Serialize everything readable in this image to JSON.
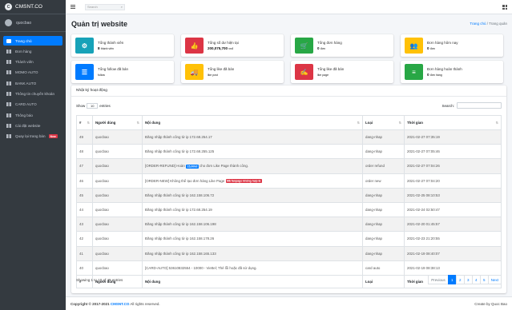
{
  "brand": {
    "name": "CMSNT.CO"
  },
  "user": {
    "name": "quocbao"
  },
  "nav": [
    {
      "label": "Trang chủ",
      "active": true
    },
    {
      "label": "Đơn hàng"
    },
    {
      "label": "Thành viên"
    },
    {
      "label": "MOMO AUTO"
    },
    {
      "label": "BANK AUTO"
    },
    {
      "label": "Thông tin chuyển khoản"
    },
    {
      "label": "CARD AUTO"
    },
    {
      "label": "Thông báo"
    },
    {
      "label": "Cài đặt website"
    },
    {
      "label": "Quay lại trang bán",
      "badge": "New"
    }
  ],
  "topbar": {
    "search_placeholder": "Search"
  },
  "header": {
    "title": "Quản trị website",
    "crumb_home": "Trang chủ",
    "crumb_sep": " / ",
    "crumb_current": "Trang quản"
  },
  "colors": {
    "teal": "#17a2b8",
    "red": "#dc3545",
    "green": "#28a745",
    "yellow": "#ffc107",
    "blue": "#007bff"
  },
  "stats": [
    {
      "label": "Tổng thành viên",
      "value": "8",
      "unit": "thành viên",
      "icon": "gear-icon",
      "color": "#17a2b8",
      "glyph": "⚙"
    },
    {
      "label": "Tổng số dư hiện tại",
      "value": "200,075,700",
      "unit": "vnđ",
      "icon": "thumbs-up-icon",
      "color": "#dc3545",
      "glyph": "👍"
    },
    {
      "label": "Tổng đơn hàng",
      "value": "0",
      "unit": "đơn",
      "icon": "cart-icon",
      "color": "#28a745",
      "glyph": "🛒"
    },
    {
      "label": "Đơn hàng hôm nay",
      "value": "0",
      "unit": "đơn",
      "icon": "users-icon",
      "color": "#ffc107",
      "glyph": "👥"
    },
    {
      "label": "Tổng follow đã bán",
      "value": "",
      "unit": "follow",
      "icon": "list-icon",
      "color": "#007bff",
      "glyph": "☰"
    },
    {
      "label": "Tổng like đã bán",
      "value": "",
      "unit": "like post",
      "icon": "truck-icon",
      "color": "#ffc107",
      "glyph": "🚚"
    },
    {
      "label": "Tổng like đã bán",
      "value": "",
      "unit": "like page",
      "icon": "signature-icon",
      "color": "#dc3545",
      "glyph": "✍"
    },
    {
      "label": "Đơn hàng hoàn thành",
      "value": "0",
      "unit": "đơn hàng",
      "icon": "align-icon",
      "color": "#28a745",
      "glyph": "≡"
    }
  ],
  "activity": {
    "title": "Nhật ký hoạt động",
    "show_label": "Show",
    "show_value": "10",
    "entries_label": "entries",
    "search_label": "Search:",
    "columns": [
      "#",
      "Người dùng",
      "Nội dung",
      "Loại",
      "Thời gian"
    ],
    "rows": [
      {
        "id": "49",
        "user": "quocbao",
        "content": "Đăng nhập thành công từ ip 172.68.254.17",
        "type": "dang-nhap",
        "time": "2021-02-27 07:35:19"
      },
      {
        "id": "48",
        "user": "quocbao",
        "content": "Đăng nhập thành công từ ip 172.68.255.125",
        "type": "dang-nhap",
        "time": "2021-02-27 07:05:46"
      },
      {
        "id": "47",
        "user": "quocbao",
        "content_pre": "[ORDER-REFUND] Hoàn ",
        "tag": "15,000đ",
        "tag_color": "blue",
        "content_post": " cho đơn Like Page thành công.",
        "type": "order refund",
        "time": "2021-02-27 07:04:26"
      },
      {
        "id": "46",
        "user": "quocbao",
        "content_pre": "[ORDER-NEW] Không thể tạo đơn hàng Like Page ",
        "tag": "Mã fanpage không hợp lệ",
        "tag_color": "red",
        "content_post": "",
        "type": "order new",
        "time": "2021-02-27 07:04:20"
      },
      {
        "id": "45",
        "user": "quocbao",
        "content": "Đăng nhập thành công từ ip 162.158.106.72",
        "type": "dang-nhap",
        "time": "2021-02-25 08:10:53"
      },
      {
        "id": "44",
        "user": "quocbao",
        "content": "Đăng nhập thành công từ ip 172.68.254.19",
        "type": "dang-nhap",
        "time": "2021-02-24 02:50:47"
      },
      {
        "id": "43",
        "user": "quocbao",
        "content": "Đăng nhập thành công từ ip 162.158.106.198",
        "type": "dang-nhap",
        "time": "2021-02-20 01:45:57"
      },
      {
        "id": "42",
        "user": "quocbao",
        "content": "Đăng nhập thành công từ ip 162.158.178.26",
        "type": "dang-nhap",
        "time": "2021-02-23 21:20:55"
      },
      {
        "id": "41",
        "user": "quocbao",
        "content": "Đăng nhập thành công từ ip 162.158.165.133",
        "type": "dang-nhap",
        "time": "2021-02-19 08:40:07"
      },
      {
        "id": "40",
        "user": "quocbao",
        "content": "[CARD-AUTO] 53610832554 - 10000 - Viettel; Thẻ lỗi hoặc đã sử dụng.",
        "type": "card auto",
        "time": "2021-02-19 08:38:13"
      }
    ],
    "info": "Showing 1 to 10 of 49 entries",
    "pagination": [
      "Previous",
      "1",
      "2",
      "3",
      "4",
      "5",
      "Next"
    ]
  },
  "footer": {
    "copyright_pre": "Copyright © 2017-2021",
    "copyright_brand": "CMSNT.CO",
    "copyright_post": " All rights reserved.",
    "credit": "Create by Quoc Bao"
  }
}
